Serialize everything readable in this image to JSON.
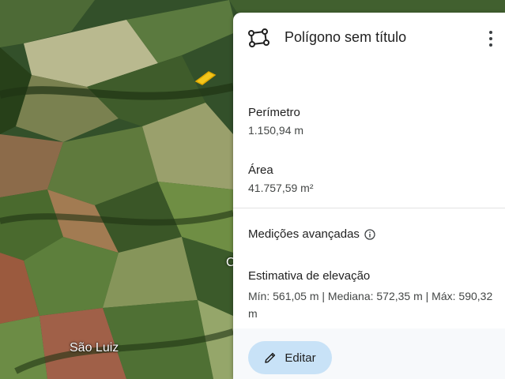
{
  "map": {
    "place_label": "São Luiz",
    "partial_label": "C",
    "polygon_color": "#f2c61c"
  },
  "panel": {
    "title": "Polígono sem título",
    "menu_icon": "more-vert-icon",
    "perimeter": {
      "label": "Perímetro",
      "value": "1.150,94 m"
    },
    "area": {
      "label": "Área",
      "value": "41.757,59 m²"
    },
    "advanced": {
      "label": "Medições avançadas",
      "icon": "info-icon"
    },
    "elevation": {
      "label": "Estimativa de elevação",
      "value": "Mín: 561,05 m | Mediana: 572,35 m | Máx: 590,32 m"
    },
    "edit_button": {
      "label": "Editar",
      "icon": "pencil-icon",
      "color": "#c8e2f7"
    }
  }
}
